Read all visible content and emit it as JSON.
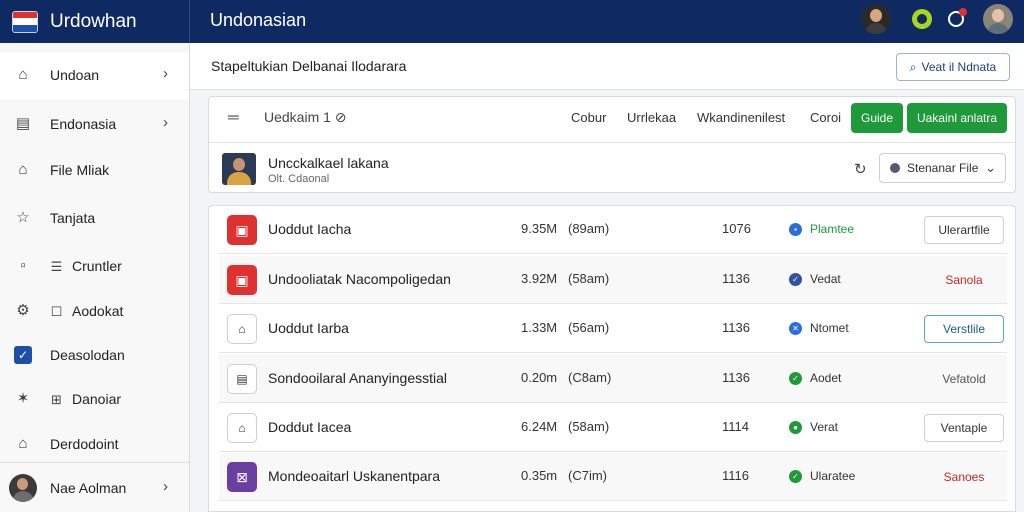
{
  "app": {
    "brand": "Urdowhan",
    "page_name": "Undonasian",
    "colors": {
      "topbar": "#0f2a63",
      "accent_green": "#1f9a3a",
      "alert_red": "#e03131"
    }
  },
  "topbar_icons": [
    "user-avatar",
    "status-ring-icon",
    "notification-icon",
    "profile-avatar"
  ],
  "sidebar": {
    "items": [
      {
        "label": "Undoan",
        "icon": "house-icon",
        "has_chevron": true
      },
      {
        "label": "Endonasia",
        "icon": "document-icon",
        "has_chevron": true
      },
      {
        "label": "File Mliak",
        "icon": "home-icon",
        "has_chevron": false
      },
      {
        "label": "Tanjata",
        "icon": "star-icon",
        "has_chevron": false
      },
      {
        "label": "Cruntler",
        "icon": "square-icon",
        "sub_icon": "list-icon",
        "has_chevron": false
      },
      {
        "label": "Aodokat",
        "icon": "gear-icon",
        "sub_icon": "checkbox-icon",
        "has_chevron": false
      },
      {
        "label": "Deasolodan",
        "icon": "checked-box-icon",
        "has_chevron": false
      },
      {
        "label": "Danoiar",
        "icon": "sparkle-icon",
        "sub_icon": "grid-icon",
        "has_chevron": false
      },
      {
        "label": "Derdodoint",
        "icon": "building-icon",
        "has_chevron": false
      }
    ],
    "footer": {
      "label": "Nae Aolman",
      "has_chevron": true
    }
  },
  "header": {
    "subtitle": "Stapeltukian Delbanai Ilodarara",
    "verify_button": "Veat il Ndnata"
  },
  "toolbar": {
    "title": "Uedkaim  1 ⊘",
    "links": [
      "Cobur",
      "Urrlekaa",
      "Wkandinenilest",
      "Coroi"
    ],
    "buttons": [
      "Guide",
      "Uakainl anlatra"
    ]
  },
  "profile": {
    "name": "Uncckalkael lakana",
    "subtitle": "Olt. Cdaonal",
    "select_label": "Stenanar File"
  },
  "files": [
    {
      "name": "Uoddut Iacha",
      "size": "9.35M",
      "duration": "(89am)",
      "count": "1076",
      "status": "Plamtee",
      "status_color": "#2a6fd6",
      "status_glyph": "▪",
      "status_green": true,
      "action": "Ulerartfile",
      "action_style": "btn",
      "icon_color": "#e03131",
      "icon_glyph": "▣"
    },
    {
      "name": "Undooliatak Nacompoligedan",
      "size": "3.92M",
      "duration": "(58am)",
      "count": "1136",
      "status": "Vedat",
      "status_color": "#3450a0",
      "status_glyph": "✓",
      "status_green": false,
      "action": "Sanola",
      "action_style": "red",
      "icon_color": "#e03131",
      "icon_glyph": "▣"
    },
    {
      "name": "Uoddut Iarba",
      "size": "1.33M",
      "duration": "(56am)",
      "count": "1136",
      "status": "Ntomet",
      "status_color": "#2a6fd6",
      "status_glyph": "✕",
      "status_green": false,
      "action": "Verstlile",
      "action_style": "btn-blue",
      "icon_color": "#ffffff",
      "icon_glyph": "⌂"
    },
    {
      "name": "Sondooilaral Ananyingesstial",
      "size": "0.20m",
      "duration": "(C8am)",
      "count": "1136",
      "status": "Aodet",
      "status_color": "#1f9a3a",
      "status_glyph": "✓",
      "status_green": false,
      "action": "Vefatold",
      "action_style": "txt",
      "icon_color": "#ffffff",
      "icon_glyph": "▤"
    },
    {
      "name": "Doddut Iacea",
      "size": "6.24M",
      "duration": "(58am)",
      "count": "1114",
      "status": "Verat",
      "status_color": "#1f9a3a",
      "status_glyph": "●",
      "status_green": false,
      "action": "Ventaple",
      "action_style": "btn",
      "icon_color": "#ffffff",
      "icon_glyph": "⌂"
    },
    {
      "name": "Mondeoaitarl Uskanentpara",
      "size": "0.35m",
      "duration": "(C7im)",
      "count": "1116",
      "status": "Ularatee",
      "status_color": "#1f9a3a",
      "status_glyph": "✓",
      "status_green": false,
      "action": "Sanoes",
      "action_style": "red",
      "icon_color": "#6b3fa0",
      "icon_glyph": "⊠"
    }
  ]
}
